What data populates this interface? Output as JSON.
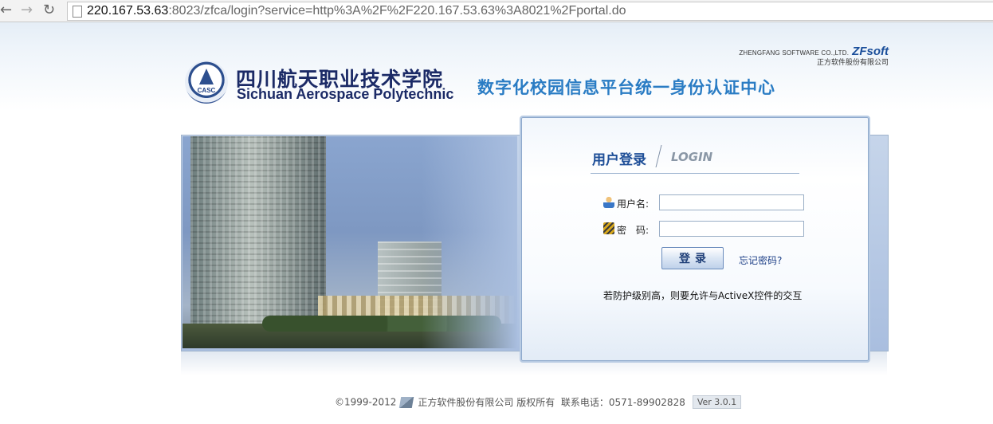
{
  "browser": {
    "url_host": "220.167.53.63",
    "url_rest": ":8023/zfca/login?service=http%3A%2F%2F220.167.53.63%3A8021%2Fportal.do",
    "back_icon": "back-arrow-icon",
    "forward_icon": "forward-arrow-icon",
    "reload_icon": "reload-icon"
  },
  "header": {
    "vendor_en": "ZHENGFANG SOFTWARE CO.,LTD.",
    "vendor_logo": "ZFsoft",
    "vendor_cn": "正方软件股份有限公司",
    "school_logo_text": "CASC",
    "school_name_cn": "四川航天职业技术学院",
    "school_name_en": "Sichuan Aerospace Polytechnic",
    "platform_title": "数字化校园信息平台统一身份认证中心"
  },
  "login": {
    "title_cn": "用户登录",
    "title_en": "LOGIN",
    "username_label": "用户名:",
    "password_label": "密　码:",
    "username_value": "",
    "password_value": "",
    "submit_label": "登录",
    "forgot_label": "忘记密码?",
    "security_note": "若防护级别高，则要允许与ActiveX控件的交互"
  },
  "footer": {
    "copyright": "©1999-2012",
    "company": "正方软件股份有限公司 版权所有",
    "phone": "联系电话：0571-89902828",
    "version": "Ver 3.0.1"
  },
  "colors": {
    "accent": "#2a7cc4",
    "title_dark": "#1f4f98",
    "panel_border": "#b8cbe3"
  }
}
